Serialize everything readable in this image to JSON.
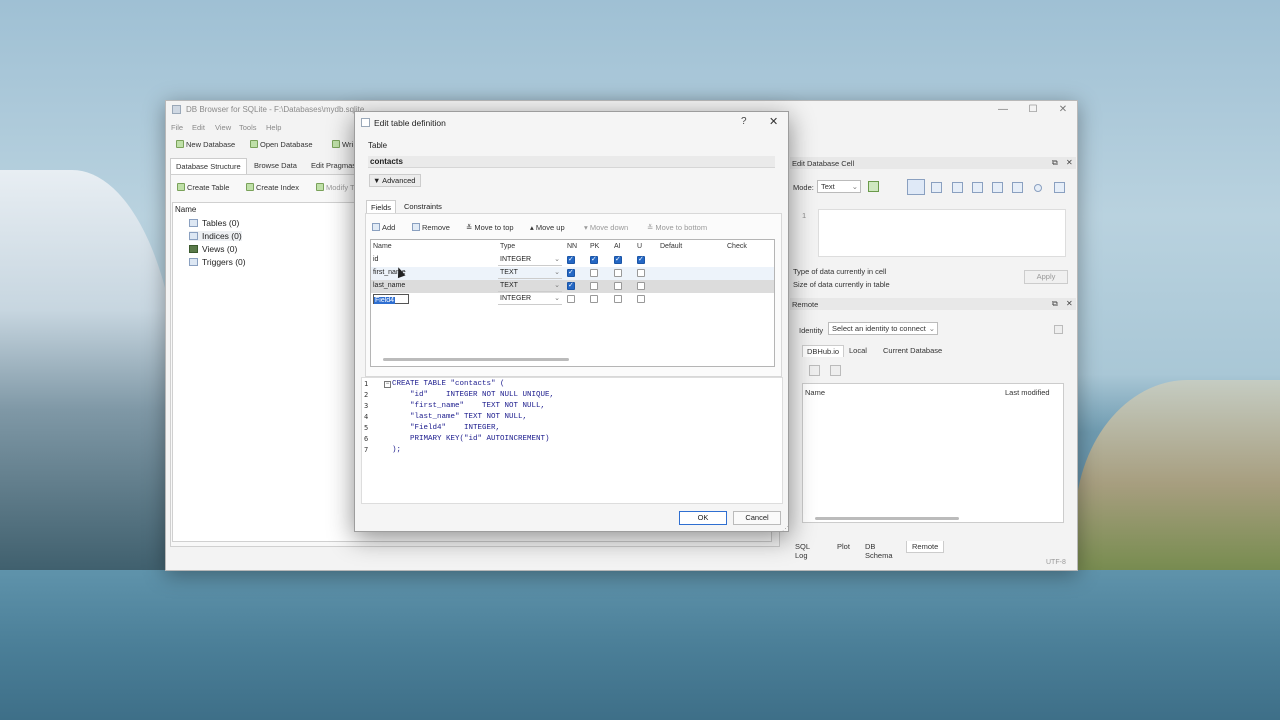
{
  "main_window": {
    "title": "DB Browser for SQLite - F:\\Databases\\mydb.sqlite",
    "controls": {
      "minimize": "—",
      "maximize": "☐",
      "close": "✕"
    },
    "menu": [
      "File",
      "Edit",
      "View",
      "Tools",
      "Help"
    ],
    "toolbar": {
      "new_db": "New Database",
      "open_db": "Open Database",
      "write": "Wri"
    },
    "tabs": [
      "Database Structure",
      "Browse Data",
      "Edit Pragmas"
    ],
    "struct_toolbar": {
      "create_table": "Create Table",
      "create_index": "Create Index",
      "modify": "Modify Ta"
    },
    "tree": {
      "header": "Name",
      "items": [
        "Tables (0)",
        "Indices (0)",
        "Views (0)",
        "Triggers (0)"
      ]
    }
  },
  "edit_cell": {
    "title": "Edit Database Cell",
    "float": "⧉",
    "close": "✕",
    "mode_label": "Mode:",
    "mode_value": "Text",
    "line_number": "1",
    "type_info": "Type of data currently in cell",
    "size_info": "Size of data currently in table",
    "apply": "Apply"
  },
  "remote": {
    "title": "Remote",
    "identity_label": "Identity",
    "identity_value": "Select an identity to connect",
    "tabs": [
      "DBHub.io",
      "Local",
      "Current Database"
    ],
    "col_name": "Name",
    "col_modified": "Last modified"
  },
  "bottom_tabs": [
    "SQL Log",
    "Plot",
    "DB Schema",
    "Remote"
  ],
  "status": "UTF-8",
  "dialog": {
    "title": "Edit table definition",
    "help": "?",
    "close": "✕",
    "table_label": "Table",
    "table_name": "contacts",
    "advanced": "Advanced",
    "tabs": [
      "Fields",
      "Constraints"
    ],
    "toolbar": {
      "add": "Add",
      "remove": "Remove",
      "move_top": "Move to top",
      "move_up": "Move up",
      "move_down": "Move down",
      "move_bottom": "Move to bottom"
    },
    "columns": [
      "Name",
      "Type",
      "NN",
      "PK",
      "AI",
      "U",
      "Default",
      "Check"
    ],
    "fields": [
      {
        "name": "id",
        "type": "INTEGER",
        "nn": true,
        "pk": true,
        "ai": true,
        "u": true
      },
      {
        "name": "first_name",
        "type": "TEXT",
        "nn": true,
        "pk": false,
        "ai": false,
        "u": false
      },
      {
        "name": "last_name",
        "type": "TEXT",
        "nn": true,
        "pk": false,
        "ai": false,
        "u": false
      },
      {
        "name": "Field4",
        "type": "INTEGER",
        "nn": false,
        "pk": false,
        "ai": false,
        "u": false
      }
    ],
    "sql_line_numbers": [
      "1",
      "2",
      "3",
      "4",
      "5",
      "6",
      "7"
    ],
    "sql_lines": [
      "CREATE TABLE \"contacts\" (",
      "    \"id\"    INTEGER NOT NULL UNIQUE,",
      "    \"first_name\"    TEXT NOT NULL,",
      "    \"last_name\" TEXT NOT NULL,",
      "    \"Field4\"    INTEGER,",
      "    PRIMARY KEY(\"id\" AUTOINCREMENT)",
      ");"
    ],
    "ok": "OK",
    "cancel": "Cancel"
  }
}
